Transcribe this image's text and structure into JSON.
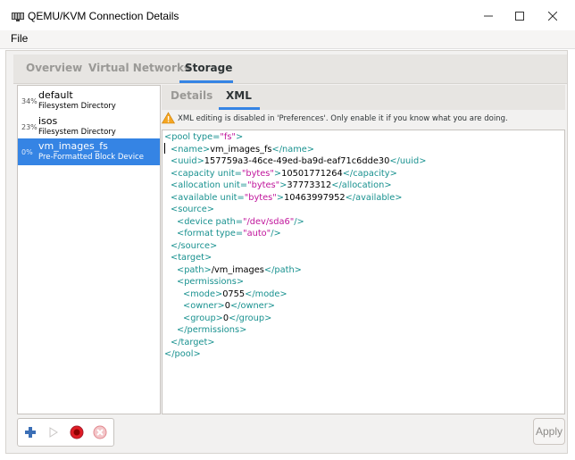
{
  "window": {
    "title": "QEMU/KVM Connection Details",
    "icons": {
      "app": "monitor-icon",
      "minimize": "minimize-icon",
      "maximize": "maximize-icon",
      "close": "close-icon"
    }
  },
  "menu": {
    "file": "File"
  },
  "tabs": [
    {
      "label": "Overview",
      "active": false
    },
    {
      "label": "Virtual Networks",
      "active": false
    },
    {
      "label": "Storage",
      "active": true
    }
  ],
  "pools": [
    {
      "percent": "34%",
      "name": "default",
      "type": "Filesystem Directory",
      "selected": false
    },
    {
      "percent": "23%",
      "name": "isos",
      "type": "Filesystem Directory",
      "selected": false
    },
    {
      "percent": "0%",
      "name": "vm_images_fs",
      "type": "Pre-Formatted Block Device",
      "selected": true
    }
  ],
  "detail_tabs": [
    {
      "label": "Details",
      "active": false
    },
    {
      "label": "XML",
      "active": true
    }
  ],
  "warning": "XML editing is disabled in 'Preferences'. Only enable it if you know what you are doing.",
  "xml_lines": [
    {
      "indent": 0,
      "parts": [
        [
          "t",
          "<pool "
        ],
        [
          "a",
          "type="
        ],
        [
          "v",
          "\"fs\""
        ],
        [
          "t",
          ">"
        ]
      ]
    },
    {
      "indent": 1,
      "parts": [
        [
          "t",
          "<name>"
        ],
        [
          "x",
          "vm_images_fs"
        ],
        [
          "t",
          "</name>"
        ]
      ]
    },
    {
      "indent": 1,
      "parts": [
        [
          "t",
          "<uuid>"
        ],
        [
          "x",
          "157759a3-46ce-49ed-ba9d-eaf71c6dde30"
        ],
        [
          "t",
          "</uuid>"
        ]
      ]
    },
    {
      "indent": 1,
      "parts": [
        [
          "t",
          "<capacity "
        ],
        [
          "a",
          "unit="
        ],
        [
          "v",
          "\"bytes\""
        ],
        [
          "t",
          ">"
        ],
        [
          "x",
          "10501771264"
        ],
        [
          "t",
          "</capacity>"
        ]
      ]
    },
    {
      "indent": 1,
      "parts": [
        [
          "t",
          "<allocation "
        ],
        [
          "a",
          "unit="
        ],
        [
          "v",
          "\"bytes\""
        ],
        [
          "t",
          ">"
        ],
        [
          "x",
          "37773312"
        ],
        [
          "t",
          "</allocation>"
        ]
      ]
    },
    {
      "indent": 1,
      "parts": [
        [
          "t",
          "<available "
        ],
        [
          "a",
          "unit="
        ],
        [
          "v",
          "\"bytes\""
        ],
        [
          "t",
          ">"
        ],
        [
          "x",
          "10463997952"
        ],
        [
          "t",
          "</available>"
        ]
      ]
    },
    {
      "indent": 1,
      "parts": [
        [
          "t",
          "<source>"
        ]
      ]
    },
    {
      "indent": 2,
      "parts": [
        [
          "t",
          "<device "
        ],
        [
          "a",
          "path="
        ],
        [
          "v",
          "\"/dev/sda6\""
        ],
        [
          "t",
          "/>"
        ]
      ]
    },
    {
      "indent": 2,
      "parts": [
        [
          "t",
          "<format "
        ],
        [
          "a",
          "type="
        ],
        [
          "v",
          "\"auto\""
        ],
        [
          "t",
          "/>"
        ]
      ]
    },
    {
      "indent": 1,
      "parts": [
        [
          "t",
          "</source>"
        ]
      ]
    },
    {
      "indent": 1,
      "parts": [
        [
          "t",
          "<target>"
        ]
      ]
    },
    {
      "indent": 2,
      "parts": [
        [
          "t",
          "<path>"
        ],
        [
          "x",
          "/vm_images"
        ],
        [
          "t",
          "</path>"
        ]
      ]
    },
    {
      "indent": 2,
      "parts": [
        [
          "t",
          "<permissions>"
        ]
      ]
    },
    {
      "indent": 3,
      "parts": [
        [
          "t",
          "<mode>"
        ],
        [
          "x",
          "0755"
        ],
        [
          "t",
          "</mode>"
        ]
      ]
    },
    {
      "indent": 3,
      "parts": [
        [
          "t",
          "<owner>"
        ],
        [
          "x",
          "0"
        ],
        [
          "t",
          "</owner>"
        ]
      ]
    },
    {
      "indent": 3,
      "parts": [
        [
          "t",
          "<group>"
        ],
        [
          "x",
          "0"
        ],
        [
          "t",
          "</group>"
        ]
      ]
    },
    {
      "indent": 2,
      "parts": [
        [
          "t",
          "</permissions>"
        ]
      ]
    },
    {
      "indent": 1,
      "parts": [
        [
          "t",
          "</target>"
        ]
      ]
    },
    {
      "indent": 0,
      "parts": [
        [
          "t",
          "</pool>"
        ]
      ]
    }
  ],
  "toolbar": {
    "add": "add-pool-icon",
    "start": "start-pool-icon",
    "stop": "stop-pool-icon",
    "delete": "delete-pool-icon",
    "apply_label": "Apply"
  },
  "colors": {
    "accent": "#3584e4",
    "xml_tag": "#18918f",
    "xml_value": "#c0149b",
    "stop_red": "#e01b24"
  }
}
